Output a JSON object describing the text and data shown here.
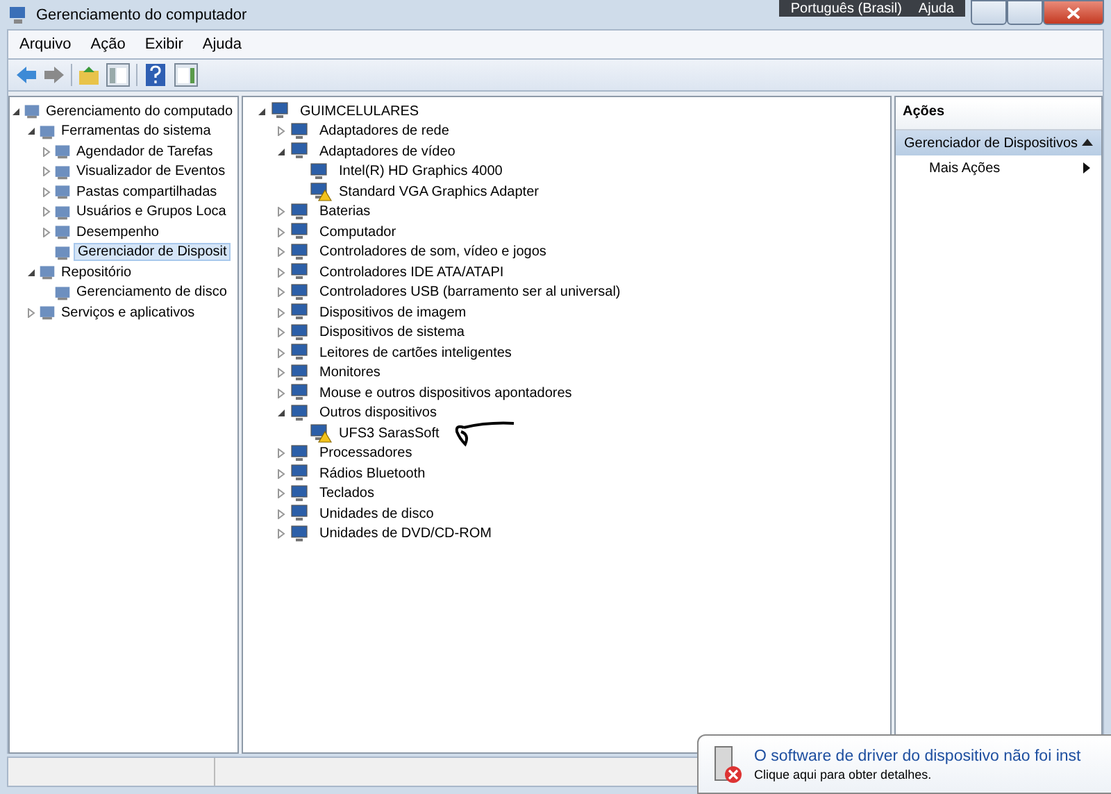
{
  "window": {
    "title": "Gerenciamento do computador"
  },
  "language_bar": {
    "language": "Português (Brasil)",
    "help": "Ajuda"
  },
  "menu": [
    "Arquivo",
    "Ação",
    "Exibir",
    "Ajuda"
  ],
  "sidebar": {
    "items": [
      {
        "label": "Gerenciamento do computado",
        "expanded": true,
        "selected": false,
        "children": [
          {
            "label": "Ferramentas do sistema",
            "expanded": true,
            "selected": false,
            "children": [
              {
                "label": "Agendador de Tarefas",
                "expanded": false,
                "selected": false
              },
              {
                "label": "Visualizador de Eventos",
                "expanded": false,
                "selected": false
              },
              {
                "label": "Pastas compartilhadas",
                "expanded": false,
                "selected": false
              },
              {
                "label": "Usuários e Grupos Loca",
                "expanded": false,
                "selected": false
              },
              {
                "label": "Desempenho",
                "expanded": false,
                "selected": false
              },
              {
                "label": "Gerenciador de Disposit",
                "selected": true
              }
            ]
          },
          {
            "label": "Repositório",
            "expanded": true,
            "selected": false,
            "children": [
              {
                "label": "Gerenciamento de disco",
                "selected": false
              }
            ]
          },
          {
            "label": "Serviços e aplicativos",
            "expanded": false,
            "selected": false
          }
        ]
      }
    ]
  },
  "device_tree": [
    {
      "label": "GUIMCELULARES",
      "expanded": true,
      "children": [
        {
          "label": "Adaptadores de rede",
          "expanded": false
        },
        {
          "label": "Adaptadores de vídeo",
          "expanded": true,
          "children": [
            {
              "label": "Intel(R) HD Graphics 4000",
              "warning": false
            },
            {
              "label": "Standard VGA Graphics Adapter",
              "warning": true
            }
          ]
        },
        {
          "label": "Baterias",
          "expanded": false
        },
        {
          "label": "Computador",
          "expanded": false
        },
        {
          "label": "Controladores de som, vídeo e jogos",
          "expanded": false
        },
        {
          "label": "Controladores IDE ATA/ATAPI",
          "expanded": false
        },
        {
          "label": "Controladores USB (barramento ser al universal)",
          "expanded": false
        },
        {
          "label": "Dispositivos de imagem",
          "expanded": false
        },
        {
          "label": "Dispositivos de sistema",
          "expanded": false
        },
        {
          "label": "Leitores de cartões inteligentes",
          "expanded": false
        },
        {
          "label": "Monitores",
          "expanded": false
        },
        {
          "label": "Mouse e outros dispositivos apontadores",
          "expanded": false
        },
        {
          "label": "Outros dispositivos",
          "expanded": true,
          "children": [
            {
              "label": "UFS3 SarasSoft",
              "warning": true
            }
          ]
        },
        {
          "label": "Processadores",
          "expanded": false
        },
        {
          "label": "Rádios Bluetooth",
          "expanded": false
        },
        {
          "label": "Teclados",
          "expanded": false
        },
        {
          "label": "Unidades de disco",
          "expanded": false
        },
        {
          "label": "Unidades de DVD/CD-ROM",
          "expanded": false
        }
      ]
    }
  ],
  "actions": {
    "title": "Ações",
    "section": {
      "label": "Gerenciador de Dispositivos",
      "expanded": true
    },
    "items": [
      "Mais Ações"
    ]
  },
  "notification": {
    "title": "O software de driver do dispositivo não foi inst",
    "subtitle": "Clique aqui para obter detalhes."
  }
}
